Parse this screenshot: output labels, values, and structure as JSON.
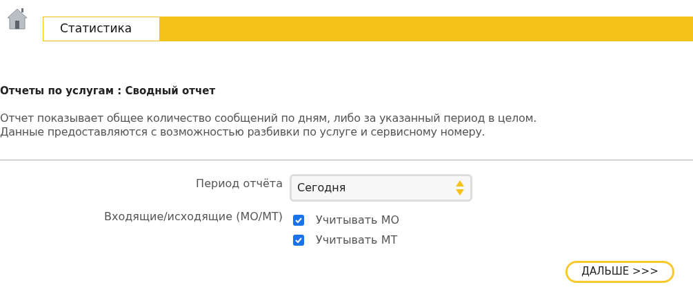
{
  "header": {
    "tab": "Статистика"
  },
  "title": "Отчеты по услугам : Сводный отчет",
  "description": [
    "Отчет показывает общее количество сообщений по дням, либо за указанный период в целом.",
    "Данные предоставляются с возможностью разбивки по услуге и сервисному номеру."
  ],
  "form": {
    "period": {
      "label": "Период отчёта",
      "value": "Сегодня"
    },
    "direction": {
      "label": "Входящие/исходящие (MO/MT)",
      "options": [
        {
          "label": "Учитывать MO",
          "checked": true
        },
        {
          "label": "Учитывать MT",
          "checked": true
        }
      ]
    }
  },
  "button": "ДАЛЬШЕ >>>"
}
